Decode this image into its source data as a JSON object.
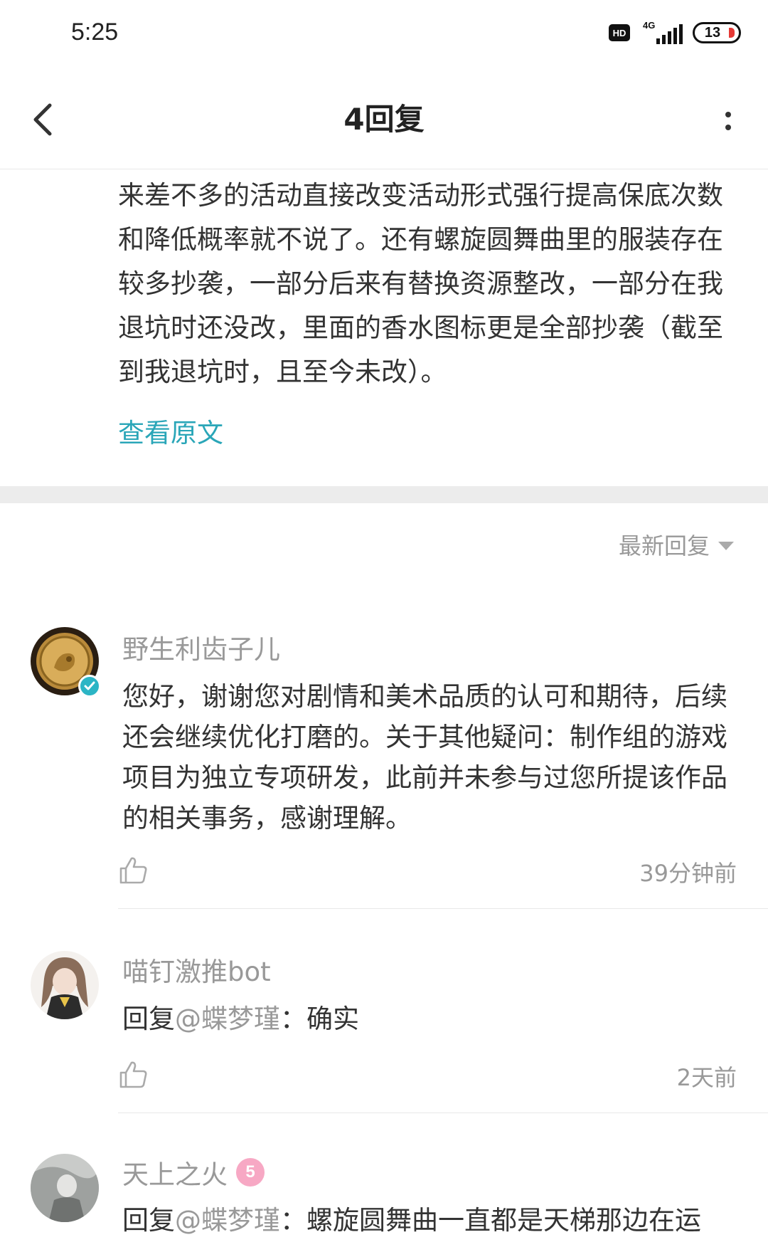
{
  "status_bar": {
    "time": "5:25",
    "hd": "HD",
    "network": "4G",
    "battery": "13",
    "battery_color": "#e53935"
  },
  "nav": {
    "title": "4回复",
    "back_icon": "chevron-left-icon",
    "more_icon": "more-vertical-icon"
  },
  "original_post": {
    "text": "来差不多的活动直接改变活动形式强行提高保底次数和降低概率就不说了。还有螺旋圆舞曲里的服装存在较多抄袭，一部分后来有替换资源整改，一部分在我退坑时还没改，里面的香水图标更是全部抄袭（截至到我退坑时，且至今未改）。",
    "view_original": "查看原文",
    "link_color": "#2aa6b8"
  },
  "sort": {
    "label": "最新回复"
  },
  "comments": [
    {
      "author": "野生利齿子儿",
      "text": "您好，谢谢您对剧情和美术品质的认可和期待，后续还会继续优化打磨的。关于其他疑问：制作组的游戏项目为独立专项研发，此前并未参与过您所提该作品的相关事务，感谢理解。",
      "time": "39分钟前",
      "verified": true
    },
    {
      "author": "喵钉激推bot",
      "reply_prefix": "回复",
      "mention": "@蝶梦瑾",
      "colon": "：",
      "text": "确实",
      "time": "2天前"
    },
    {
      "author": "天上之火",
      "level": "5",
      "reply_prefix": "回复",
      "mention": "@蝶梦瑾",
      "colon": "：",
      "text": "螺旋圆舞曲一直都是天梯那边在运"
    }
  ]
}
